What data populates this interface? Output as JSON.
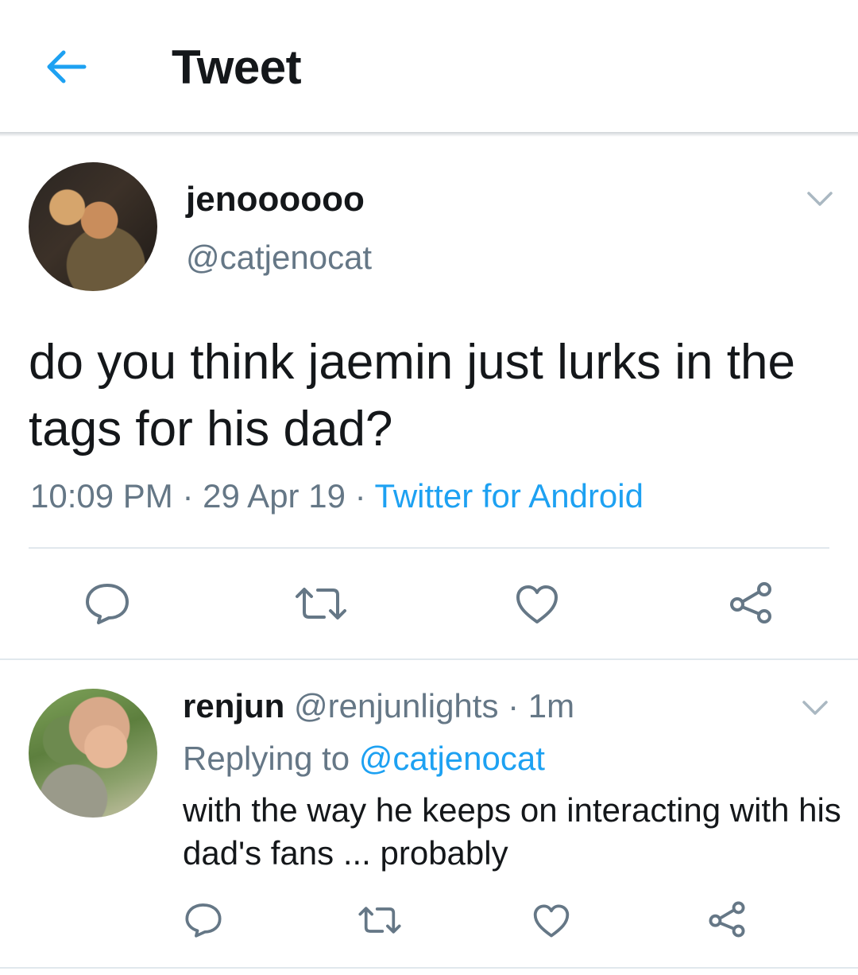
{
  "header": {
    "title": "Tweet",
    "back_icon": "arrow-left-icon",
    "accent": "#1da1f2"
  },
  "tweet": {
    "display_name": "jenoooooo",
    "handle": "@catjenocat",
    "text": "do you think jaemin just lurks in the tags for his dad?",
    "time": "10:09 PM",
    "date": "29 Apr 19",
    "source": "Twitter for Android",
    "separator": " · ",
    "actions": [
      "reply-icon",
      "retweet-icon",
      "like-icon",
      "share-icon"
    ]
  },
  "reply": {
    "display_name": "renjun",
    "handle": "@renjunlights",
    "age": "1m",
    "separator": " · ",
    "replying_prefix": "Replying to ",
    "replying_to": "@catjenocat",
    "text": "with the way he keeps on interacting with his dad's fans ... probably",
    "actions": [
      "reply-icon",
      "retweet-icon",
      "like-icon",
      "share-icon"
    ]
  },
  "colors": {
    "text": "#14171a",
    "secondary": "#657786",
    "link": "#1da1f2",
    "divider": "#e1e8ed",
    "icon": "#657786"
  }
}
